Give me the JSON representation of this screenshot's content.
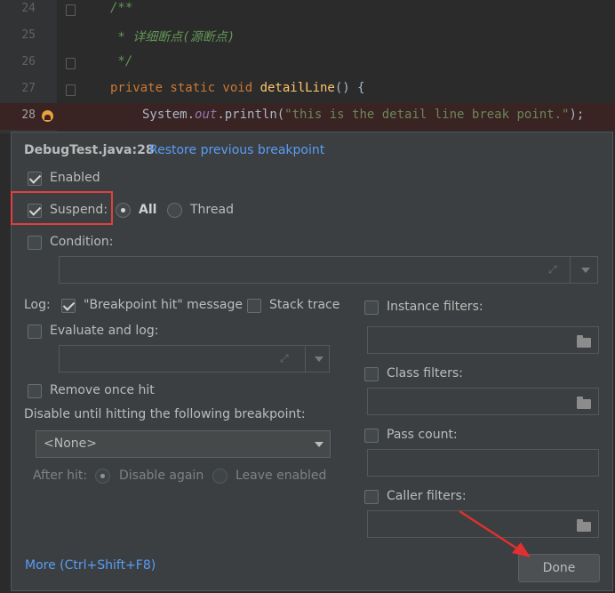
{
  "editor": {
    "lines": [
      {
        "num": "24",
        "text": "/**"
      },
      {
        "num": "25",
        "text": " * 详细断点(源断点)"
      },
      {
        "num": "26",
        "text": " */"
      },
      {
        "num": "27",
        "kw": "private static void ",
        "fn": "detailLine",
        "rest": "() {"
      },
      {
        "num": "28",
        "p1": "System.",
        "field": "out",
        "p2": ".println(",
        "str": "\"this is the detail line break point.\"",
        "p3": ");"
      }
    ]
  },
  "dialog": {
    "location": "DebugTest.java:28",
    "restore_link": "Restore previous breakpoint",
    "enabled_label": "Enabled",
    "enabled_checked": true,
    "suspend_label": "Suspend:",
    "suspend_checked": true,
    "suspend_all": "All",
    "suspend_thread": "Thread",
    "suspend_selected": "All",
    "condition_label": "Condition:",
    "log_label": "Log:",
    "log_message_label": "\"Breakpoint hit\" message",
    "log_message_checked": true,
    "stack_trace_label": "Stack trace",
    "evaluate_label": "Evaluate and log:",
    "remove_once_label": "Remove once hit",
    "disable_until_label": "Disable until hitting the following breakpoint:",
    "disable_until_value": "<None>",
    "after_hit_label": "After hit:",
    "disable_again_label": "Disable again",
    "leave_enabled_label": "Leave enabled",
    "instance_filters_label": "Instance filters:",
    "class_filters_label": "Class filters:",
    "pass_count_label": "Pass count:",
    "caller_filters_label": "Caller filters:",
    "more_link": "More (Ctrl+Shift+F8)",
    "done_label": "Done"
  },
  "icons": {
    "breakpoint": "breakpoint-icon",
    "expand": "expand-icon",
    "folder": "folder-icon",
    "dropdown": "chevron-down-icon"
  },
  "colors": {
    "accent_link": "#589df6",
    "highlight_box": "#e04040",
    "annotation_arrow": "#e03030"
  }
}
